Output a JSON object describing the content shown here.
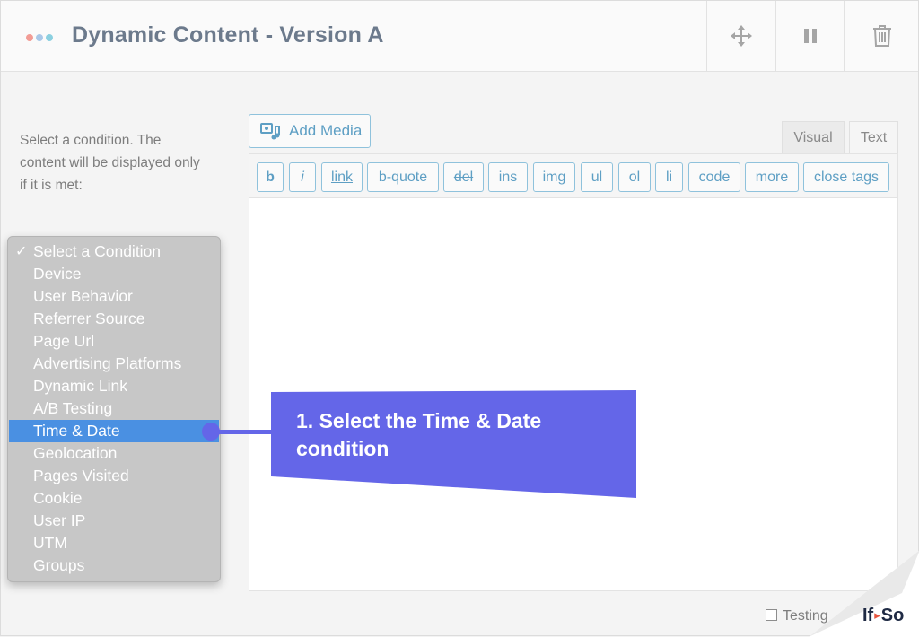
{
  "header": {
    "title": "Dynamic Content - Version A",
    "dot_colors": [
      "#f29c95",
      "#a9c8e8",
      "#8bd0e0"
    ],
    "move_icon": "move-arrows-icon",
    "pause_icon": "pause-icon",
    "delete_icon": "trash-icon"
  },
  "description": "Select a condition. The content will be displayed only if it is met:",
  "condition_dropdown": {
    "checked_option": "Select a Condition",
    "highlighted_option": "Time & Date",
    "options": [
      "Select a Condition",
      "Device",
      "User Behavior",
      "Referrer Source",
      "Page Url",
      "Advertising Platforms",
      "Dynamic Link",
      "A/B Testing",
      "Time & Date",
      "Geolocation",
      "Pages Visited",
      "Cookie",
      "User IP",
      "UTM",
      "Groups"
    ]
  },
  "editor": {
    "add_media_label": "Add Media",
    "tabs": [
      "Visual",
      "Text"
    ],
    "toolbar_buttons": [
      "b",
      "i",
      "link",
      "b-quote",
      "del",
      "ins",
      "img",
      "ul",
      "ol",
      "li",
      "code",
      "more",
      "close tags"
    ],
    "content": ""
  },
  "callout": {
    "text": "1. Select the Time & Date condition",
    "color": "#6466e8"
  },
  "footer": {
    "testing_label": "Testing"
  },
  "brand": {
    "logo_left": "If",
    "logo_right": "So",
    "logo_arrow": "▸"
  }
}
